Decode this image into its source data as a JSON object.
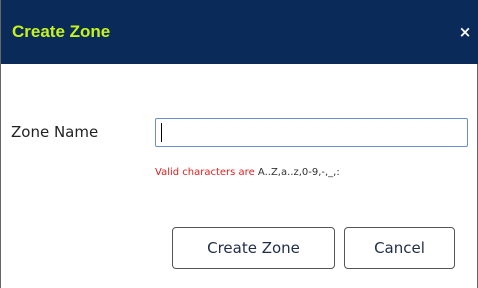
{
  "dialog": {
    "title": "Create Zone",
    "title_color": "#c6f31a",
    "titlebar_color": "#0a2a5a",
    "close_icon": "close-icon",
    "close_glyph": "×"
  },
  "form": {
    "zone_name_label": "Zone Name",
    "zone_name_value": "",
    "zone_name_placeholder": "",
    "hint_prefix": "Valid characters are",
    "hint_chars": "A..Z,a..z,0-9,-,_,:",
    "hint_prefix_color": "#e02020"
  },
  "buttons": {
    "create_label": "Create Zone",
    "cancel_label": "Cancel"
  }
}
